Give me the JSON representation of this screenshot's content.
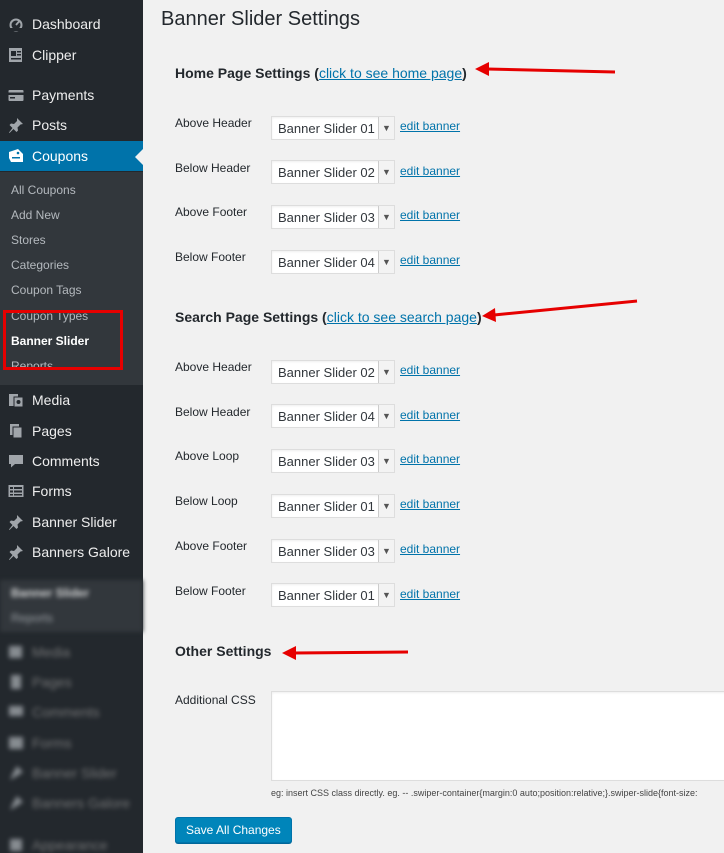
{
  "sidebar": {
    "top_items": [
      {
        "label": "Dashboard",
        "icon": "dashboard-icon"
      },
      {
        "label": "Clipper",
        "icon": "clipper-icon"
      },
      {
        "label": "Payments",
        "icon": "payments-icon"
      },
      {
        "label": "Posts",
        "icon": "pin-icon"
      },
      {
        "label": "Coupons",
        "icon": "coupons-icon"
      }
    ],
    "submenu": [
      "All Coupons",
      "Add New",
      "Stores",
      "Categories",
      "Coupon Tags",
      "Coupon Types",
      "Banner Slider",
      "Reports"
    ],
    "bottom_items": [
      {
        "label": "Media",
        "icon": "media-icon"
      },
      {
        "label": "Pages",
        "icon": "pages-icon"
      },
      {
        "label": "Comments",
        "icon": "comments-icon"
      },
      {
        "label": "Forms",
        "icon": "forms-icon"
      },
      {
        "label": "Banner Slider",
        "icon": "pin-icon"
      },
      {
        "label": "Banners Galore",
        "icon": "pin-icon"
      }
    ],
    "blurred_sub": [
      "Banner Slider",
      "Reports"
    ],
    "blurred_items": [
      "Media",
      "Pages",
      "Comments",
      "Forms",
      "Banner Slider",
      "Banners Galore",
      "Appearance"
    ],
    "active_color": "#0073aa",
    "highlight_color": "#e60000"
  },
  "main": {
    "title": "Banner Slider Settings",
    "home": {
      "title": "Home Page Settings",
      "link": "click to see home page",
      "rows": [
        {
          "label": "Above Header",
          "value": "Banner Slider 01"
        },
        {
          "label": "Below Header",
          "value": "Banner Slider 02"
        },
        {
          "label": "Above Footer",
          "value": "Banner Slider 03"
        },
        {
          "label": "Below Footer",
          "value": "Banner Slider 04"
        }
      ]
    },
    "search": {
      "title": "Search Page Settings",
      "link": "click to see search page",
      "rows": [
        {
          "label": "Above Header",
          "value": "Banner Slider 02"
        },
        {
          "label": "Below Header",
          "value": "Banner Slider 04"
        },
        {
          "label": "Above Loop",
          "value": "Banner Slider 03"
        },
        {
          "label": "Below Loop",
          "value": "Banner Slider 01"
        },
        {
          "label": "Above Footer",
          "value": "Banner Slider 03"
        },
        {
          "label": "Below Footer",
          "value": "Banner Slider 01"
        }
      ]
    },
    "edit_label": "edit banner",
    "other": {
      "title": "Other Settings",
      "css_label": "Additional CSS",
      "hint": "eg: insert CSS class directly. eg. -- .swiper-container{margin:0 auto;position:relative;}.swiper-slide{font-size:"
    },
    "save_label": "Save All Changes"
  }
}
